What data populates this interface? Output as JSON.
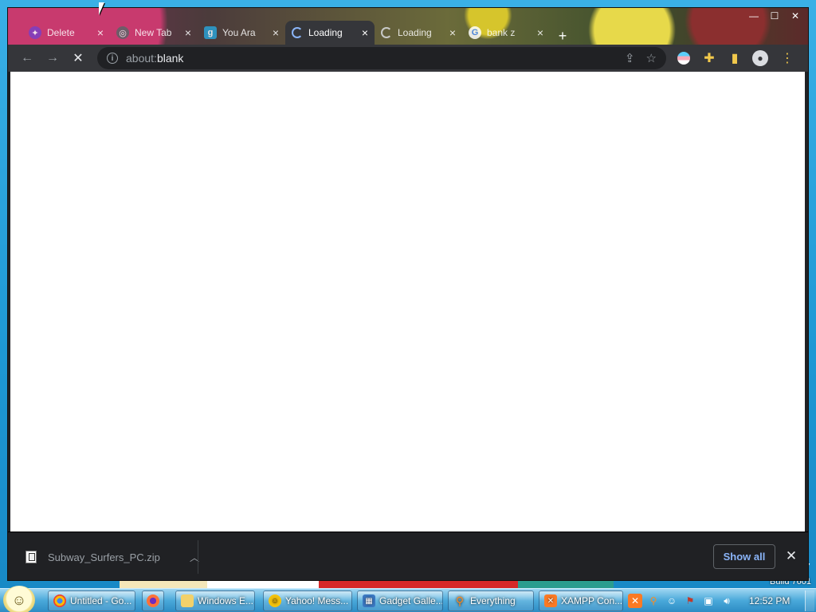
{
  "browser": {
    "tabs": [
      {
        "label": "Delete",
        "favicon": "purple-app-icon",
        "state": "inactive"
      },
      {
        "label": "New Tab",
        "favicon": "chrome-icon",
        "state": "inactive"
      },
      {
        "label": "You Ara",
        "favicon": "g-letter-icon",
        "state": "inactive"
      },
      {
        "label": "Loading",
        "favicon": "spinner-icon",
        "state": "active"
      },
      {
        "label": "Loading",
        "favicon": "spinner-icon",
        "state": "inactive"
      },
      {
        "label": "bank z",
        "favicon": "google-icon",
        "state": "inactive"
      }
    ],
    "new_tab_glyph": "+",
    "address": {
      "scheme": "about:",
      "path": "blank"
    },
    "window_controls": {
      "minimize": "—",
      "maximize": "☐",
      "close": "✕"
    }
  },
  "download_bar": {
    "filename": "Subway_Surfers_PC.zip",
    "show_all_label": "Show all"
  },
  "desktop": {
    "build_text": "Build 7601",
    "edge_number": "7"
  },
  "taskbar": {
    "buttons": [
      {
        "label": "Untitled - Go...",
        "icon": "chrome-icon"
      },
      {
        "label": "",
        "icon": "firefox-icon"
      },
      {
        "label": "Windows E...",
        "icon": "folder-icon"
      },
      {
        "label": "Yahoo! Mess...",
        "icon": "yahoo-messenger-icon"
      },
      {
        "label": "Gadget Galle...",
        "icon": "gadget-icon"
      },
      {
        "label": "Everything",
        "icon": "search-magnifier-icon"
      },
      {
        "label": "XAMPP Con...",
        "icon": "xampp-icon"
      }
    ],
    "clock": "12:52 PM"
  },
  "colors": {
    "chrome_dark": "#202124",
    "toolbar": "#35363a",
    "link_blue": "#8ab4f8",
    "taskbar_blue": "#4aa9da"
  }
}
